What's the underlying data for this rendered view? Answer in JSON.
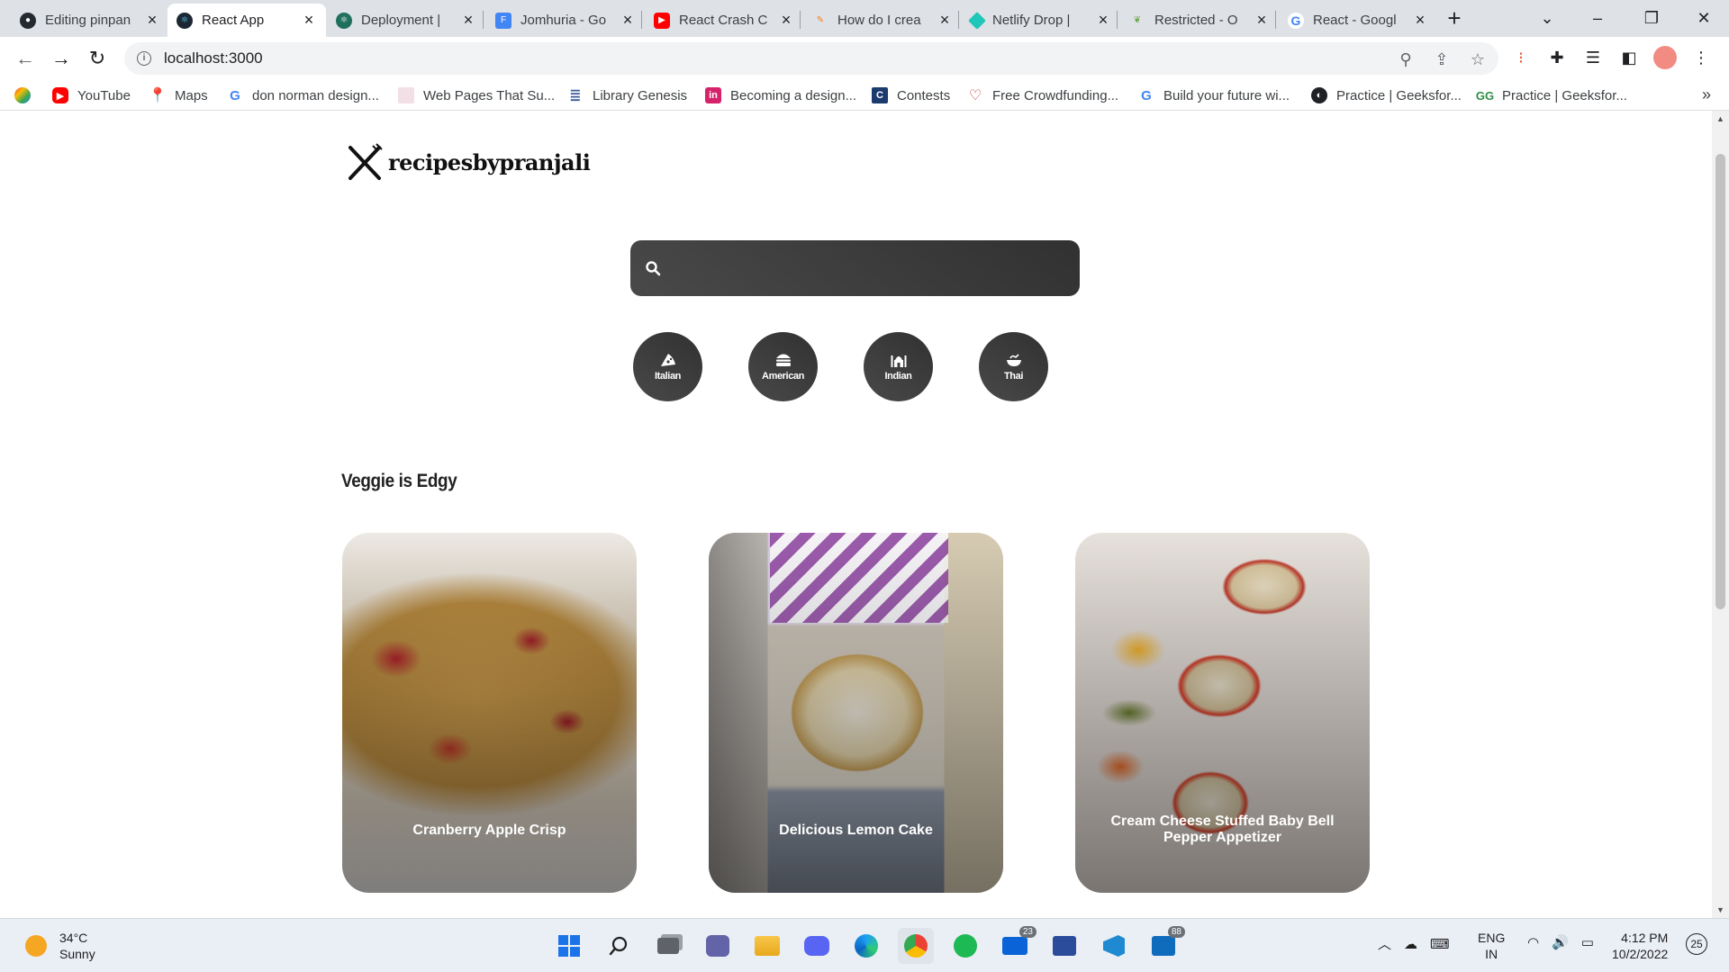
{
  "browser": {
    "tabs": [
      {
        "title": "Editing pinpan",
        "favicon": "github-icon",
        "color": "#24292f",
        "active": false
      },
      {
        "title": "React App",
        "favicon": "react-icon",
        "color": "#61dafb",
        "active": true
      },
      {
        "title": "Deployment |",
        "favicon": "react-icon",
        "color": "#1f6f5c",
        "active": false
      },
      {
        "title": "Jomhuria - Go",
        "favicon": "google-fonts-icon",
        "color": "#4285f4",
        "active": false
      },
      {
        "title": "React Crash C",
        "favicon": "youtube-icon",
        "color": "#ff0000",
        "active": false
      },
      {
        "title": "How do I crea",
        "favicon": "stackoverflow-icon",
        "color": "#f48024",
        "active": false
      },
      {
        "title": "Netlify Drop |",
        "favicon": "netlify-icon",
        "color": "#20c6b7",
        "active": false
      },
      {
        "title": "Restricted - O",
        "favicon": "leaf-icon",
        "color": "#6aa84f",
        "active": false
      },
      {
        "title": "React - Googl",
        "favicon": "google-icon",
        "color": "#4285f4",
        "active": false
      }
    ],
    "url": "localhost:3000",
    "bookmarks": [
      {
        "label": "",
        "icon": "apps-icon",
        "color": "#ea4335"
      },
      {
        "label": "YouTube",
        "icon": "youtube-icon",
        "color": "#ff0000"
      },
      {
        "label": "Maps",
        "icon": "maps-icon",
        "color": "#34a853"
      },
      {
        "label": "don norman design...",
        "icon": "google-icon",
        "color": "#4285f4"
      },
      {
        "label": "Web Pages That Su...",
        "icon": "webpage-icon",
        "color": "#e8a3b8"
      },
      {
        "label": "Library Genesis",
        "icon": "library-icon",
        "color": "#3b5b9b"
      },
      {
        "label": "Becoming a design...",
        "icon": "bookmark-in-icon",
        "color": "#d6226a"
      },
      {
        "label": "Contests",
        "icon": "contests-icon",
        "color": "#1a3b6e"
      },
      {
        "label": "Free Crowdfunding...",
        "icon": "heart-hand-icon",
        "color": "#c0392b"
      },
      {
        "label": "Build your future wi...",
        "icon": "google-icon",
        "color": "#4285f4"
      },
      {
        "label": "Practice | Geeksfor...",
        "icon": "globe-icon",
        "color": "#202124"
      },
      {
        "label": "Practice | Geeksfor...",
        "icon": "gfg-icon",
        "color": "#2f8d46"
      }
    ]
  },
  "page": {
    "logo_text": "recipesbypranjali",
    "search_value": "",
    "cuisines": [
      {
        "label": "Italian",
        "icon": "pizza-icon"
      },
      {
        "label": "American",
        "icon": "hamburger-icon"
      },
      {
        "label": "Indian",
        "icon": "taj-mahal-icon"
      },
      {
        "label": "Thai",
        "icon": "noodle-bowl-icon"
      }
    ],
    "section_title": "Veggie is Edgy",
    "recipes": [
      {
        "title": "Cranberry Apple Crisp"
      },
      {
        "title": "Delicious Lemon Cake"
      },
      {
        "title": "Cream Cheese Stuffed Baby Bell Pepper Appetizer"
      }
    ]
  },
  "taskbar": {
    "temperature": "34°C",
    "weather": "Sunny",
    "mail_badge": "23",
    "outlook_badge": "88",
    "lang_line1": "ENG",
    "lang_line2": "IN",
    "time": "4:12 PM",
    "date": "10/2/2022",
    "notification_count": "25"
  }
}
